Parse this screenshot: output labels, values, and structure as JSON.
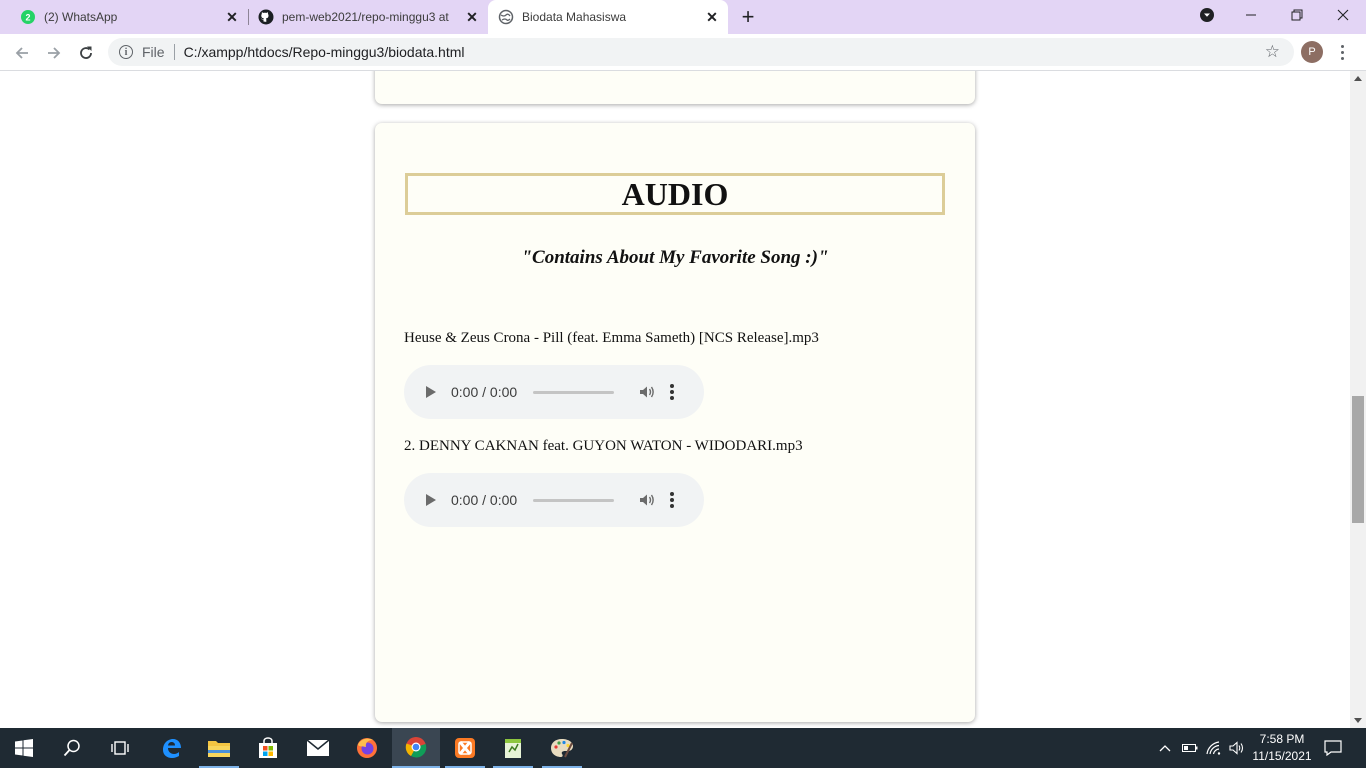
{
  "browser": {
    "tabs": [
      {
        "title": "(2) WhatsApp",
        "favicon": "whatsapp-icon",
        "badge": "2"
      },
      {
        "title": "pem-web2021/repo-minggu3 at",
        "favicon": "github-icon"
      },
      {
        "title": "Biodata Mahasiswa",
        "favicon": "globe-icon",
        "active": true
      }
    ],
    "new_tab_label": "+",
    "address": {
      "scheme_label": "File",
      "url": "C:/xampp/htdocs/Repo-minggu3/biodata.html"
    },
    "profile_initial": "P"
  },
  "page": {
    "audio_section": {
      "heading": "AUDIO",
      "tagline": "\"Contains About My Favorite Song :)\"",
      "songs": [
        {
          "label": "Heuse & Zeus Crona - Pill (feat. Emma Sameth) [NCS Release].mp3",
          "time": "0:00 / 0:00"
        },
        {
          "label": "2. DENNY CAKNAN feat. GUYON WATON - WIDODARI.mp3",
          "time": "0:00 / 0:00"
        }
      ]
    },
    "colors": {
      "card_background": "#fefef7",
      "heading_border": "#dccd98",
      "tab_strip": "#e3d5f5",
      "taskbar": "#1f2a33"
    }
  },
  "taskbar": {
    "apps": [
      "windows-start-icon",
      "search-icon",
      "task-view-icon",
      "edge-icon",
      "file-explorer-icon",
      "store-icon",
      "mail-icon",
      "firefox-icon",
      "chrome-icon",
      "xampp-icon",
      "notepad-plus-icon",
      "paint-icon"
    ],
    "clock": {
      "time": "7:58 PM",
      "date": "11/15/2021"
    }
  }
}
